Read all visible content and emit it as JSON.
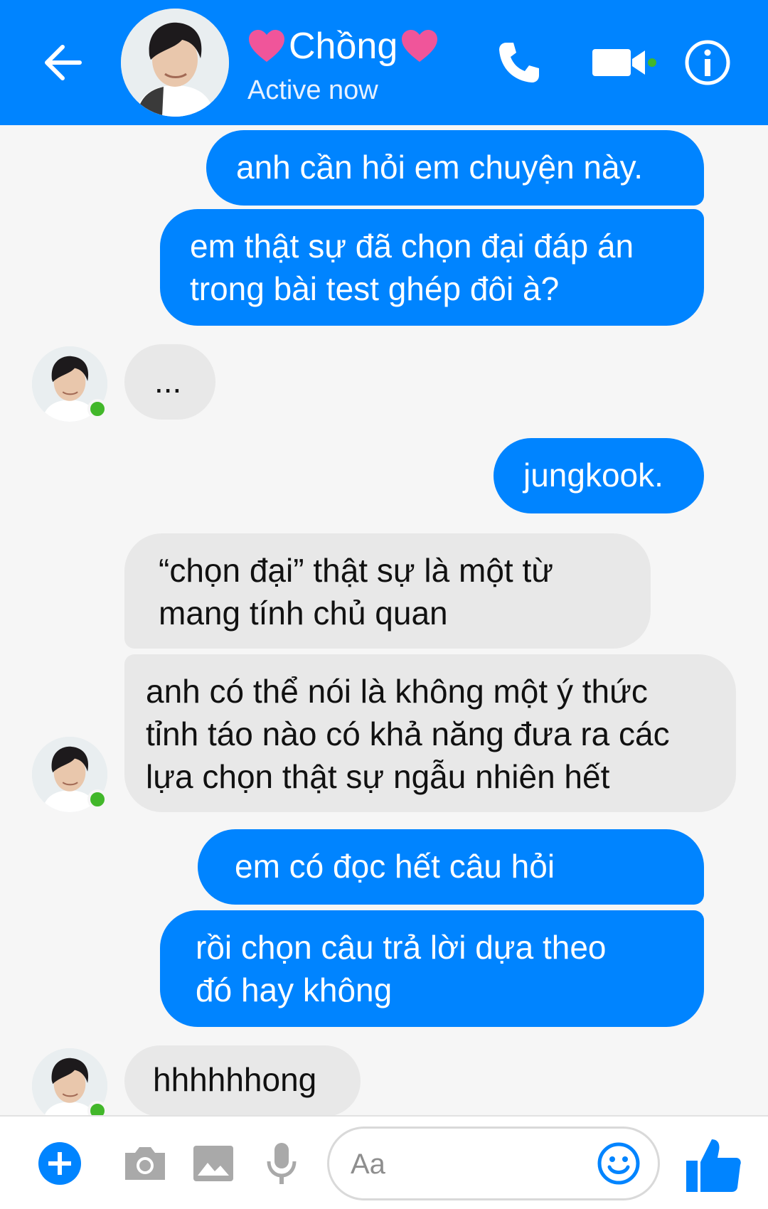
{
  "header": {
    "contact_name": "Chồng",
    "status": "Active now",
    "heart_icon": "heart-icon",
    "accent_color": "#0084ff",
    "heart_color": "#f0559a",
    "online_color": "#42b72a"
  },
  "messages": [
    {
      "side": "out",
      "text_lines": [
        "anh cần hỏi em chuyện này."
      ]
    },
    {
      "side": "out",
      "text_lines": [
        "em thật sự đã chọn đại đáp án",
        "trong bài test ghép đôi à?"
      ]
    },
    {
      "side": "in",
      "text_lines": [
        "..."
      ]
    },
    {
      "side": "out",
      "text_lines": [
        "jungkook."
      ]
    },
    {
      "side": "in",
      "text_lines": [
        "“chọn đại” thật sự là một từ",
        "mang tính chủ quan"
      ]
    },
    {
      "side": "in",
      "text_lines": [
        "anh có thể nói là không một ý thức",
        "tỉnh táo nào có khả năng đưa ra các",
        "lựa chọn thật sự ngẫu nhiên hết"
      ]
    },
    {
      "side": "out",
      "text_lines": [
        "em có đọc hết câu hỏi"
      ]
    },
    {
      "side": "out",
      "text_lines": [
        "rồi chọn câu trả lời dựa theo",
        "đó hay không"
      ]
    },
    {
      "side": "in",
      "text_lines": [
        "hhhhhhong"
      ]
    }
  ],
  "composer": {
    "placeholder": "Aa",
    "value": ""
  },
  "icons": [
    "back-arrow-icon",
    "phone-icon",
    "video-camera-icon",
    "info-icon",
    "plus-icon",
    "camera-icon",
    "image-icon",
    "microphone-icon",
    "emoji-icon",
    "thumbs-up-icon"
  ]
}
